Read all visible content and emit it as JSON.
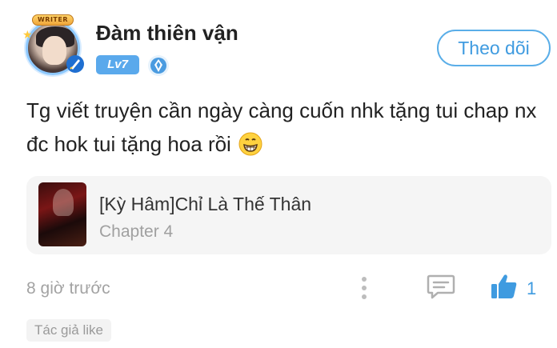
{
  "user": {
    "name": "Đàm thiên vận",
    "level": "Lv7",
    "avatar_badge": "WRITER",
    "follow_label": "Theo dõi"
  },
  "comment": {
    "text": "Tg viết truyện cần ngày càng cuốn nhk tặng tui chap nx đc hok tui tặng hoa rồi",
    "emoji": "grinning-face"
  },
  "story": {
    "title": "[Kỳ Hâm]Chỉ Là Thế Thân",
    "chapter": "Chapter 4"
  },
  "footer": {
    "timestamp": "8 giờ trước",
    "like_count": "1",
    "author_like": "Tác giả like"
  },
  "colors": {
    "accent": "#3f9be0",
    "level_badge": "#5aa9ec",
    "muted_text": "#a3a3a3"
  }
}
